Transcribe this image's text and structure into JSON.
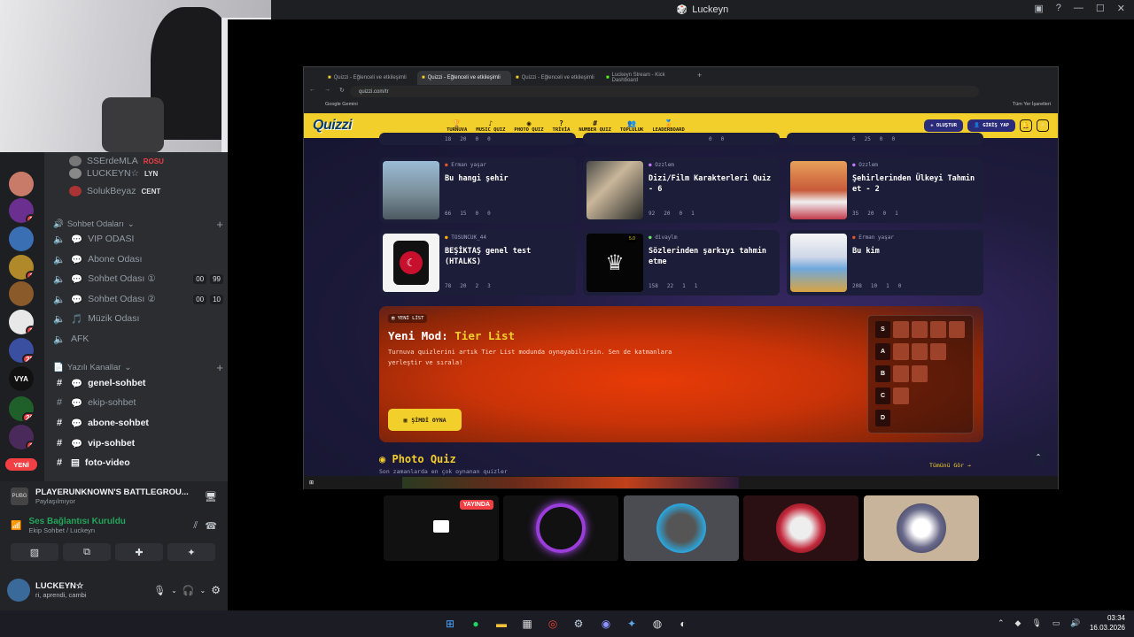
{
  "window": {
    "title": "Luckeyn"
  },
  "members": [
    {
      "name": "SSErdeMLA",
      "tag": "ROSU"
    },
    {
      "name": "LUCKEYN☆",
      "tag": "LYN"
    },
    {
      "name": "SolukBeyaz",
      "tag": "CENT"
    }
  ],
  "voice_category": "Sohbet Odaları",
  "voice_channels": [
    {
      "name": "VIP ODASI"
    },
    {
      "name": "Abone Odası"
    },
    {
      "name": "Sohbet Odası ①",
      "c1": "00",
      "c2": "99"
    },
    {
      "name": "Sohbet Odası ②",
      "c1": "00",
      "c2": "10"
    },
    {
      "name": "Müzik Odası"
    },
    {
      "name": "AFK"
    }
  ],
  "text_category": "Yazılı Kanallar",
  "text_channels": [
    "genel-sohbet",
    "ekip-sohbet",
    "abone-sohbet",
    "vip-sohbet",
    "foto-video"
  ],
  "rail_badges": [
    "2",
    "1",
    "1",
    "22",
    "26",
    "1"
  ],
  "rail_new": "YENİ",
  "activity": {
    "title": "PLAYERUNKNOWN'S BATTLEGROU...",
    "sub": "Paylaşılmıyor"
  },
  "voice_status": {
    "title": "Ses Bağlantısı Kuruldu",
    "sub": "Ekip Sohbet / Luckeyn"
  },
  "user": {
    "name": "LUCKEYN☆",
    "status": "ri, aprendi, cambi"
  },
  "browser": {
    "tabs": [
      "Quizzi - Eğlenceli ve etkileşimli",
      "Quizzi - Eğlenceli ve etkileşimli",
      "Quizzi - Eğlenceli ve etkileşimli",
      "Luckeyn Stream - Kick Dashboard"
    ],
    "url": "quizzi.com/tr",
    "bookmark": "Google Gemini",
    "bookmarks_right": "Tüm Yer İşaretleri"
  },
  "site": {
    "logo": "Quizzi",
    "nav": [
      "TURNUVA",
      "MUSIC QUIZ",
      "PHOTO QUIZ",
      "TRİVİA",
      "NUMBER QUIZ",
      "TOPLULUK",
      "LEADERBOARD"
    ],
    "create": "OLUŞTUR",
    "login": "GİRİŞ YAP",
    "top_stats": [
      [
        "18",
        "20",
        "0",
        "0"
      ],
      [
        "",
        "",
        "0",
        "0"
      ],
      [
        "6",
        "25",
        "0",
        "0"
      ]
    ],
    "cards": [
      {
        "author": "Erman yaşar",
        "title": "Bu hangi şehir",
        "stats": [
          "66",
          "15",
          "0",
          "0"
        ]
      },
      {
        "author": "Ozzlem",
        "title": "Dizi/Film Karakterleri Quiz - 6",
        "stats": [
          "92",
          "20",
          "0",
          "1"
        ]
      },
      {
        "author": "Ozzlem",
        "title": "Şehirlerinden Ülkeyi Tahmin et - 2",
        "stats": [
          "35",
          "20",
          "0",
          "1"
        ]
      },
      {
        "author": "TOSUNCUK_44",
        "title": "BEŞİKTAŞ genel test (HTALKS)",
        "stats": [
          "78",
          "20",
          "2",
          "3"
        ]
      },
      {
        "author": "divaylm",
        "title": "Sözlerinden şarkıyı tahmin etme",
        "stats": [
          "158",
          "22",
          "1",
          "1"
        ]
      },
      {
        "author": "Erman yaşar",
        "title": "Bu kim",
        "stats": [
          "208",
          "10",
          "1",
          "0"
        ]
      }
    ],
    "rating": "5.0",
    "tier": {
      "badge": "YENİ LİST",
      "title_a": "Yeni Mod:",
      "title_b": "Tier List",
      "desc": "Turnuva quizlerini artık Tier List modunda oynayabilirsin. Sen de katmanlara yerleştir ve sırala!",
      "button": "ŞİMDİ OYNA",
      "rows": [
        "S",
        "A",
        "B",
        "C",
        "D"
      ]
    },
    "photo_quiz": "Photo Quiz",
    "photo_sub": "Son zamanlarda en çok oynanan quizler",
    "see_all": "Tümünü Gör →"
  },
  "live_badge": "YAYINDA",
  "clock": {
    "time": "03:34",
    "date": "16.03.2026"
  },
  "colors": {
    "accent": "#f3cf2b",
    "live": "#f23f43",
    "discord_bg": "#2b2d31",
    "voice_green": "#23a55a"
  }
}
